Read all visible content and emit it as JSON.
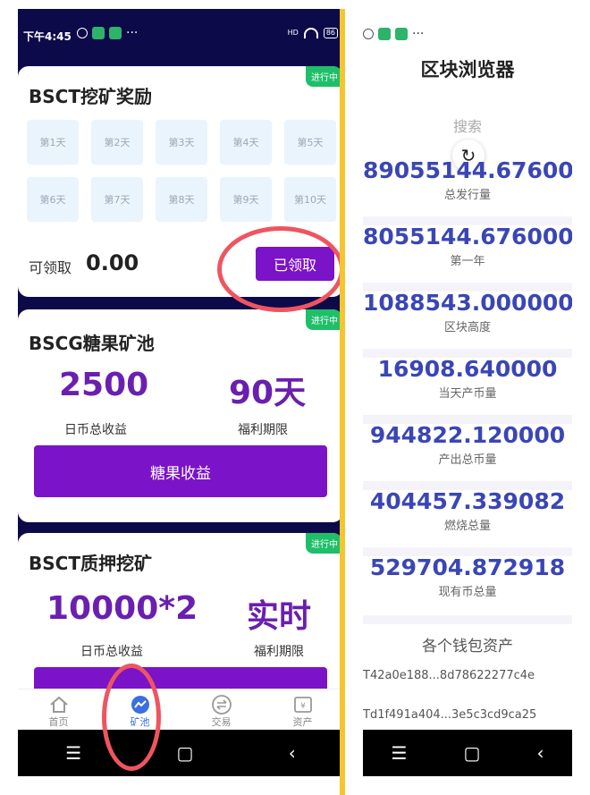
{
  "left": {
    "status": {
      "time": "下午4:45",
      "battery": "86",
      "network": "HD"
    },
    "cards": [
      {
        "title": "BSCT挖矿奖励",
        "badge": "进行中",
        "days": [
          "第1天",
          "第2天",
          "第3天",
          "第4天",
          "第5天",
          "第6天",
          "第7天",
          "第8天",
          "第9天",
          "第10天"
        ],
        "claimable_label": "可领取",
        "claimable_value": "0.00",
        "button": "已领取"
      },
      {
        "title": "BSCG糖果矿池",
        "badge": "进行中",
        "stat1_value": "2500",
        "stat1_label": "日币总收益",
        "stat2_value": "90天",
        "stat2_label": "福利期限",
        "button": "糖果收益"
      },
      {
        "title": "BSCT质押挖矿",
        "badge": "进行中",
        "stat1_value": "10000*2",
        "stat1_label": "日币总收益",
        "stat2_value": "实时",
        "stat2_label": "福利期限"
      }
    ],
    "tabs": [
      {
        "label": "首页",
        "icon": "home-icon"
      },
      {
        "label": "矿池",
        "icon": "chart-trend-icon",
        "active": true
      },
      {
        "label": "交易",
        "icon": "exchange-icon"
      },
      {
        "label": "资产",
        "icon": "wallet-icon"
      }
    ],
    "navbar": {
      "menu": "☰",
      "home": "▢",
      "back": "‹"
    }
  },
  "right": {
    "title": "区块浏览器",
    "search": "搜索",
    "metrics": [
      {
        "value": "89055144.676000",
        "label": "总发行量"
      },
      {
        "value": "8055144.676000",
        "label": "第一年"
      },
      {
        "value": "1088543.000000",
        "label": "区块高度"
      },
      {
        "value": "16908.640000",
        "label": "当天产币量"
      },
      {
        "value": "944822.120000",
        "label": "产出总币量"
      },
      {
        "value": "404457.339082",
        "label": "燃烧总量"
      },
      {
        "value": "529704.872918",
        "label": "现有币总量"
      }
    ],
    "wallet_title": "各个钱包资产",
    "wallets": [
      "T42a0e188...8d78622277c4e",
      "Td1f491a404...3e5c3cd9ca25"
    ],
    "navbar": {
      "menu": "☰",
      "home": "▢",
      "back": "‹"
    }
  },
  "colors": {
    "purple": "#7b13c8",
    "stat_purple": "#6a1fb0",
    "metric_blue": "#3a46b5",
    "badge_green": "#1fbf6a",
    "highlight_red": "#ee5560",
    "divider_yellow": "#f4c52f"
  }
}
